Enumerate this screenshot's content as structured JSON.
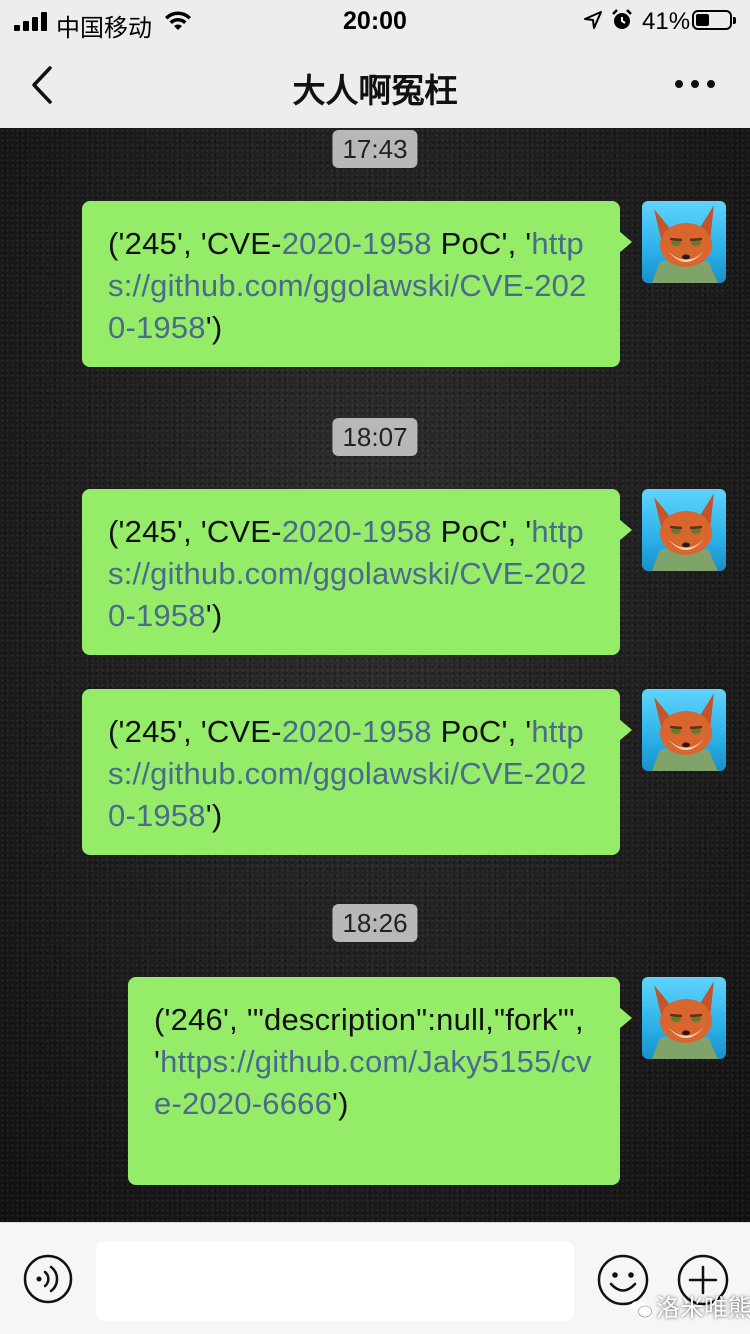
{
  "status_bar": {
    "carrier": "中国移动",
    "time": "20:00",
    "battery_percent_text": "41%",
    "battery_level": 0.41
  },
  "nav": {
    "title": "大人啊冤枉",
    "back_icon": "chevron-left-icon",
    "more_icon": "ellipsis-icon"
  },
  "chat": {
    "timestamps": [
      "17:43",
      "18:07",
      "18:26"
    ],
    "messages": [
      {
        "prefix": "('245', 'CVE-",
        "mid_link": "2020-1958",
        "mid": " PoC', '",
        "link": "https://github.com/ggolawski/CVE-2020-1958",
        "suffix": "')"
      },
      {
        "prefix": "('245', 'CVE-",
        "mid_link": "2020-1958",
        "mid": " PoC', '",
        "link": "https://github.com/ggolawski/CVE-2020-1958",
        "suffix": "')"
      },
      {
        "prefix": "('245', 'CVE-",
        "mid_link": "2020-1958",
        "mid": " PoC', '",
        "link": "https://github.com/ggolawski/CVE-2020-1958",
        "suffix": "')"
      },
      {
        "prefix": "('246', '\"description\":null,\"fork\"', '",
        "link": "https://github.com/Jaky5155/cve-2020-6666",
        "suffix": "')"
      }
    ]
  },
  "input_bar": {
    "placeholder": "",
    "voice_icon": "voice-icon",
    "emoji_icon": "emoji-icon",
    "plus_icon": "plus-icon"
  },
  "watermark": "洛米唯熊",
  "colors": {
    "bubble": "#95ec69",
    "link": "#4b6b8c",
    "bar_bg": "#ededed"
  }
}
